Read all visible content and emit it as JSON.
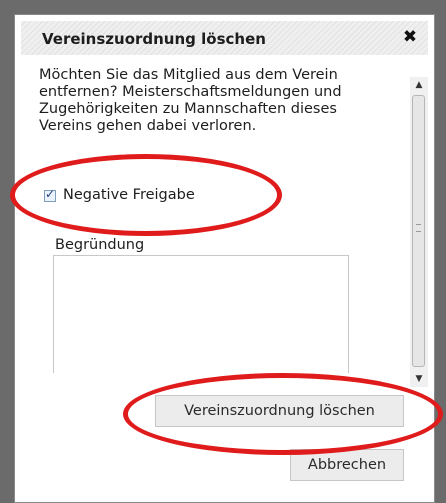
{
  "dialog": {
    "title": "Vereinszuordnung löschen",
    "close_icon": "close-icon",
    "message": "Möchten Sie das Mitglied aus dem Verein entfernen? Meisterschaftsmeldungen und Zugehörigkeiten zu Mannschaften dieses Vereins gehen dabei verloren.",
    "checkbox": {
      "label": "Negative Freigabe",
      "checked": true
    },
    "reason": {
      "label": "Begründung",
      "value": ""
    },
    "buttons": {
      "delete": "Vereinszuordnung löschen",
      "cancel": "Abbrechen"
    }
  },
  "colors": {
    "annotation": "#e01b1b",
    "page_background": "#6b6b6b"
  }
}
